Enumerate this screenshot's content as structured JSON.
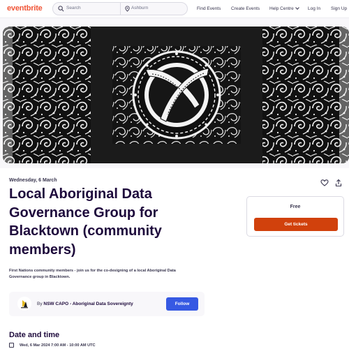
{
  "header": {
    "logo": "eventbrite",
    "search_placeholder": "Search",
    "location": "Ashburn",
    "nav": {
      "find_events": "Find Events",
      "create_events": "Create Events",
      "help_centre": "Help Centre",
      "log_in": "Log In",
      "sign_up": "Sign Up"
    }
  },
  "event": {
    "date_label": "Wednesday, 6 March",
    "title": "Local Aboriginal Data Governance Group for Blacktown (community members)",
    "summary": "First Nations community members - join us for the co-designing of a local Aboriginal Data Governance group in Blacktown."
  },
  "organizer": {
    "by": "By",
    "name": "NSW CAPO - Aboriginal Data Sovereignty",
    "follow_label": "Follow"
  },
  "ticket": {
    "price": "Free",
    "button_label": "Get tickets"
  },
  "date_time": {
    "heading": "Date and time",
    "value": "Wed, 6 Mar 2024 7:00 AM - 10:00 AM UTC"
  },
  "icons": {
    "like": "heart-icon",
    "share": "share-icon",
    "search": "search-icon",
    "location": "location-pin-icon",
    "calendar": "calendar-icon"
  },
  "colors": {
    "brand": "#f05537",
    "cta": "#d1410c",
    "follow": "#3659e3",
    "text": "#1e0a3c"
  }
}
